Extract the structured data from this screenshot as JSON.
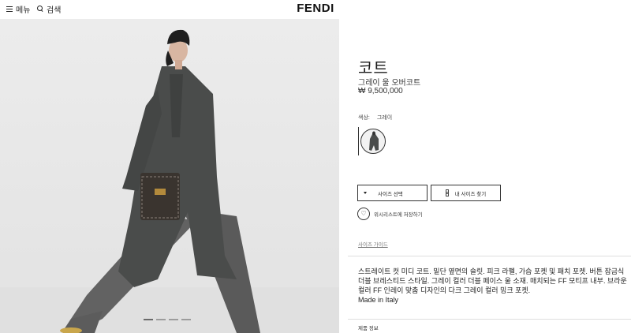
{
  "header": {
    "menu_label": "메뉴",
    "search_label": "검색",
    "logo": "FENDI"
  },
  "gallery": {
    "slide_count": 4,
    "active_index": 0
  },
  "product": {
    "title": "코트",
    "subtitle": "그레이 울 오버코트",
    "price": "₩ 9,500,000",
    "color_label": "색상:",
    "color_value": "그레이",
    "size_select_label": "사이즈 선택",
    "my_size_label": "내 사이즈 찾기",
    "wishlist_label": "위시리스트에 저장하기",
    "size_guide_label": "사이즈 가이드",
    "description": "스트레이트 컷 미디 코트. 밑단 옆면의 슬릿. 피크 라펠, 가슴 포켓 및 패치 포켓. 버튼 잠금식 더블 브레스티드 스타일. 그레이 컬러 더블 페이스 울 소재. 매치되는 FF 모티프 내부. 브라운 컬러 FF 인레이 맞춤 디자인의 다크 그레이 컬러 밍크 포켓.",
    "made_in": "Made in Italy",
    "product_info_label": "제품 정보"
  },
  "colors": {
    "accent": "#222222",
    "coat": "#4a4c4b",
    "background": "#e8e8e8"
  }
}
